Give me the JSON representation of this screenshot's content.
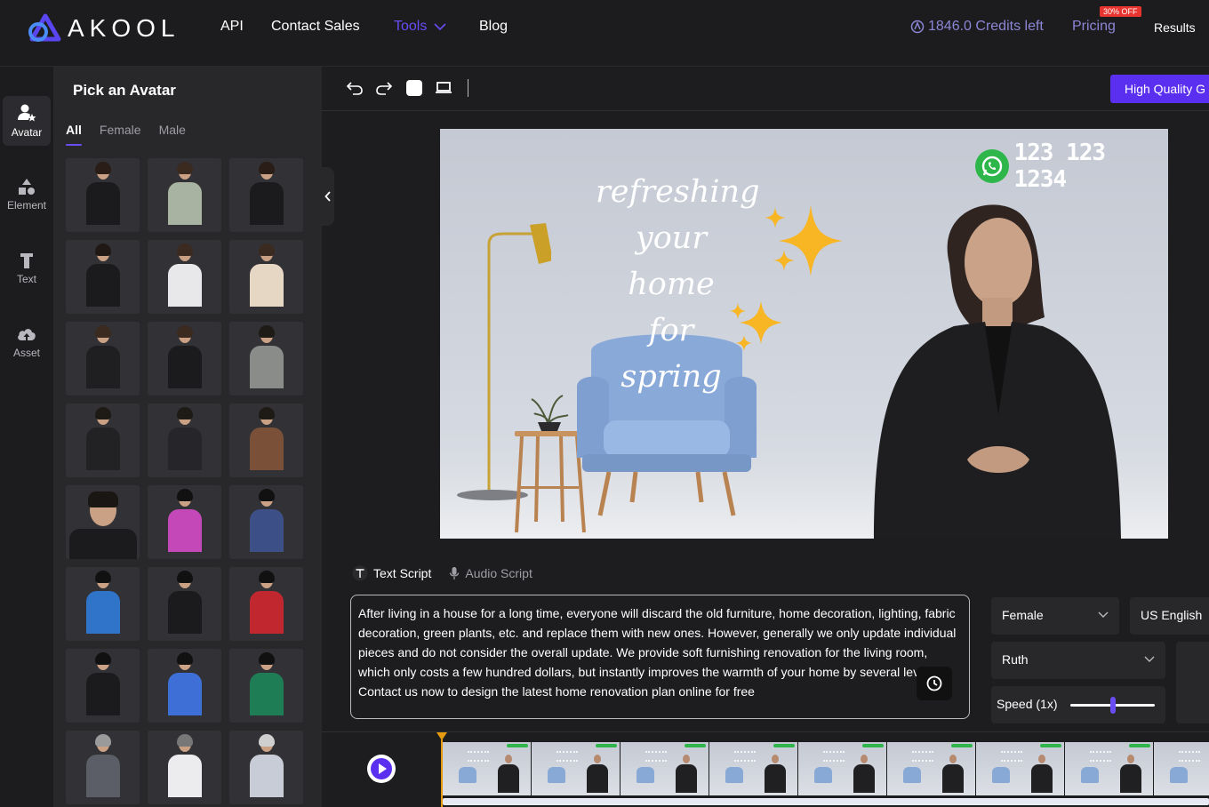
{
  "nav": {
    "logo_text": "AKOOL",
    "links": [
      "API",
      "Contact Sales",
      "Tools",
      "Blog"
    ],
    "credits": "1846.0 Credits left",
    "pricing": "Pricing",
    "pricing_badge": "30% OFF",
    "results": "Results",
    "accent_color": "#6a4cf5"
  },
  "rail": {
    "items": [
      {
        "label": "Avatar",
        "icon": "avatar-icon"
      },
      {
        "label": "Element",
        "icon": "shapes-icon"
      },
      {
        "label": "Text",
        "icon": "text-icon"
      },
      {
        "label": "Asset",
        "icon": "cloud-upload-icon"
      }
    ]
  },
  "panel": {
    "title": "Pick an Avatar",
    "tabs": [
      "All",
      "Female",
      "Male"
    ],
    "active_tab": "All",
    "avatar_count": 24
  },
  "toolbar": {
    "hq_button": "High Quality G"
  },
  "canvas": {
    "headline_lines": [
      "refreshing",
      "your home",
      "for spring"
    ],
    "phone": "123 123 1234"
  },
  "script": {
    "tabs": [
      "Text Script",
      "Audio Script"
    ],
    "active_tab": "Text Script",
    "text": "After living in a house for a long time, everyone will discard the old furniture, home decoration, lighting, fabric decoration, green plants, etc. and replace them with new ones. However, generally we only update individual pieces and do not consider the overall update. We provide soft furnishing renovation for the living room, which only costs a few hundred dollars, but instantly improves the warmth of your home by several levels! Contact us now to design the latest home renovation plan online for free"
  },
  "voice": {
    "gender": "Female",
    "language": "US English",
    "voice_name": "Ruth",
    "speed_label": "Speed (1x)",
    "speed_level": 0.5
  },
  "timeline": {
    "frame_count": 9
  }
}
